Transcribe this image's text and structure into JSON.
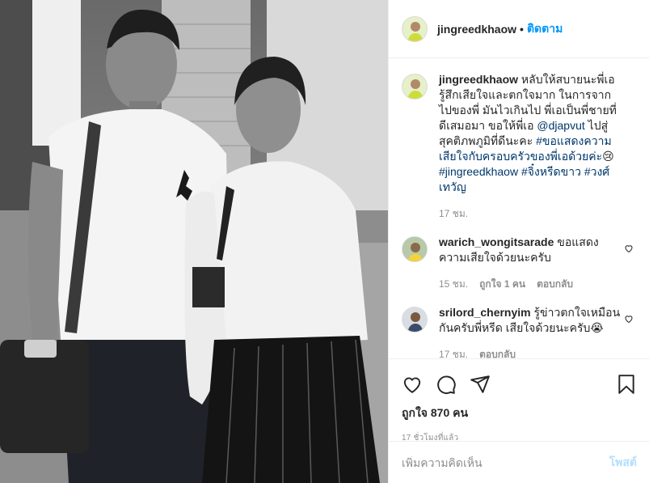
{
  "post": {
    "photo_alt": "",
    "username": "jingreedkhaow",
    "separator": "•",
    "follow_label": "ติดตาม"
  },
  "caption": {
    "username": "jingreedkhaow",
    "text_part1": "หลับให้สบายนะพี่เอ รู้สึกเสียใจและตกใจมาก ในการจากไปของพี่ มันไวเกินไป พี่เอเป็นพี่ชายที่ดีเสมอมา ขอให้พี่เอ",
    "mention": "@djapvut",
    "text_part2": "ไปสู่สุคติภพภูมิที่ดีนะคะ",
    "hashtag1": "#ขอแสดงความเสียใจกับครอบครัวของพี่เอด้วยค่ะ",
    "emoji1": "😢",
    "hashtag2": "#jingreedkhaow",
    "hashtag3": "#จิ๋งหรีดขาว",
    "hashtag4": "#วงศ์เทวัญ",
    "time": "17 ชม."
  },
  "comments": [
    {
      "username": "warich_wongitsarade",
      "text": "ขอแสดงความเสียใจด้วยนะครับ",
      "time": "15 ชม.",
      "likes": "ถูกใจ 1 คน",
      "reply": "ตอบกลับ",
      "heart_icon": "heart-outline-icon"
    },
    {
      "username": "srilord_chernyim",
      "text": "รู้ข่าวตกใจเหมือนกันครับพี่หรีด เสียใจด้วยนะครับ",
      "emoji": "😭",
      "time": "17 ชม.",
      "reply": "ตอบกลับ",
      "heart_icon": "heart-outline-icon"
    }
  ],
  "actions": {
    "icons": [
      "heart-icon",
      "comment-icon",
      "share-icon",
      "bookmark-icon"
    ],
    "likes_text": "ถูกใจ 870 คน",
    "time_ago": "17 ชั่วโมงที่แล้ว"
  },
  "add_comment": {
    "placeholder": "เพิ่มความคิดเห็น",
    "post_label": "โพสต์"
  },
  "colors": {
    "link_blue": "#0095f6",
    "hashtag_blue": "#00376b",
    "muted": "#8e8e8e",
    "post_disabled": "#b2dffc"
  }
}
